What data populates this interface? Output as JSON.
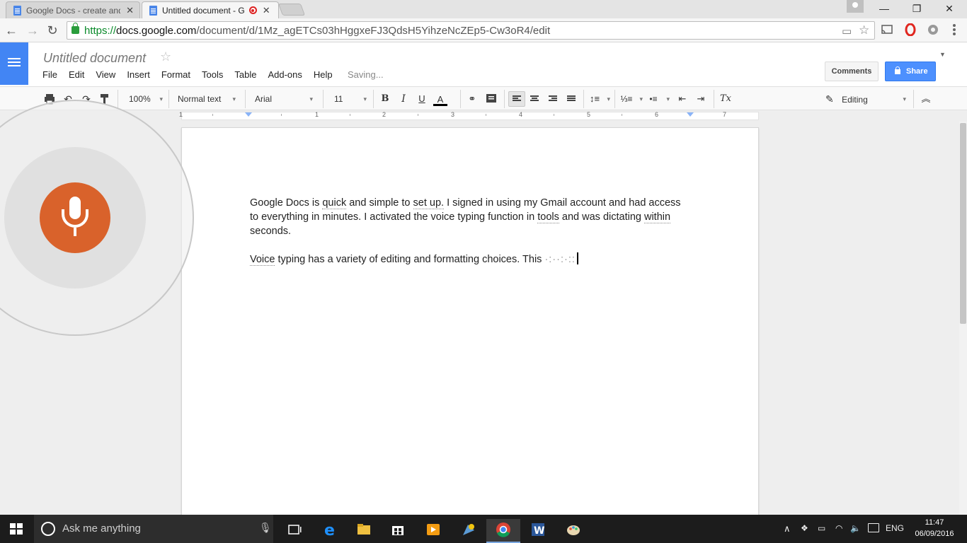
{
  "browser": {
    "tabs": [
      {
        "title": "Google Docs - create and",
        "active": false
      },
      {
        "title": "Untitled document - G",
        "active": true
      }
    ],
    "url": {
      "scheme": "https://",
      "host": "docs.google.com",
      "path": "/document/d/1Mz_agETCs03hHggxeFJ3QdsH5YihzeNcZEp5-Cw3oR4/edit"
    },
    "window_controls": {
      "minimize": "—",
      "restore": "❐",
      "close": "✕"
    }
  },
  "docs": {
    "title": "Untitled document",
    "menu": [
      "File",
      "Edit",
      "View",
      "Insert",
      "Format",
      "Tools",
      "Table",
      "Add-ons",
      "Help"
    ],
    "status": "Saving...",
    "comments_label": "Comments",
    "share_label": "Share"
  },
  "toolbar": {
    "zoom": "100%",
    "style": "Normal text",
    "font": "Arial",
    "font_size": "11",
    "bold": "B",
    "italic": "I",
    "underline": "U",
    "text_color": "A",
    "clear_format": "Tx",
    "mode": "Editing"
  },
  "ruler": {
    "labels": [
      "1",
      "1",
      "2",
      "3",
      "4",
      "5",
      "6",
      "7"
    ]
  },
  "document": {
    "para1": {
      "a": "Google Docs is ",
      "b": "quick",
      "c": " and simple to ",
      "d": "set up.",
      "e": " I signed in using my Gmail account and had access to everything in minutes. I activated the voice typing function in ",
      "f": "tools",
      "g": " and was dictating  ",
      "h": "within",
      "i": " seconds."
    },
    "para2": {
      "a": "Voice",
      "b": " typing has a variety of editing and formatting choices. This ",
      "c": "·:··:·::"
    }
  },
  "voice_typing": {
    "state": "listening",
    "accent_color": "#d9622b"
  },
  "taskbar": {
    "search_placeholder": "Ask me anything",
    "language": "ENG",
    "time": "11:47",
    "date": "06/09/2016"
  },
  "colors": {
    "docs_blue": "#4285f4",
    "share_blue": "#4d90fe",
    "mic_orange": "#d9622b"
  }
}
